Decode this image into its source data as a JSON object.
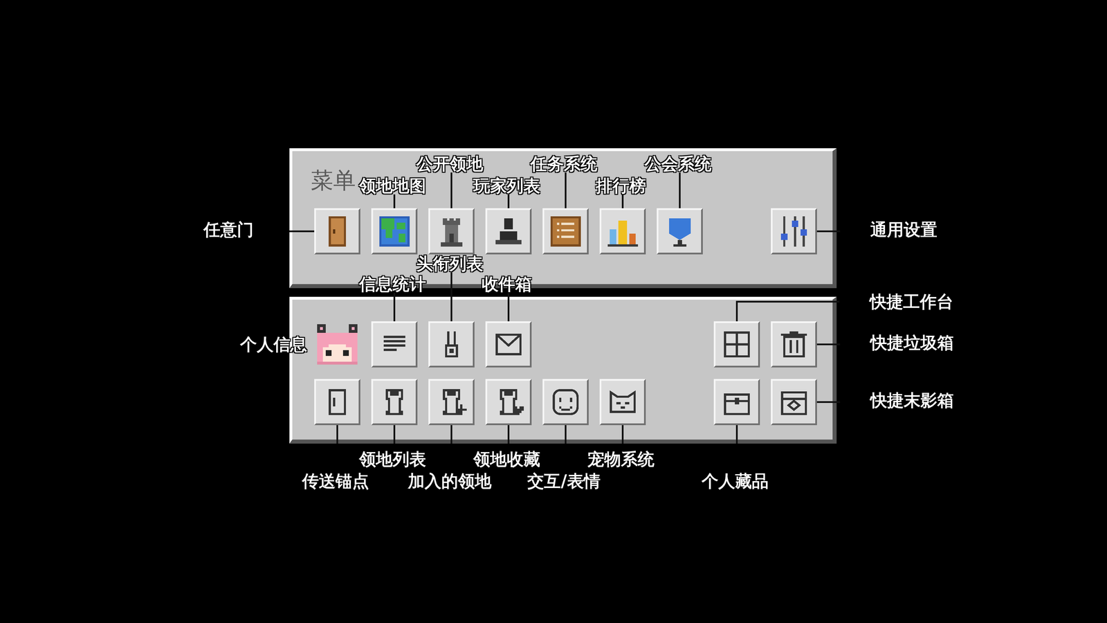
{
  "top_panel": {
    "title": "菜单",
    "left": [
      {
        "label": "任意门",
        "side": "left",
        "tier": 1,
        "kind": "slot"
      },
      {
        "label": "领地地图",
        "side": "top",
        "tier": 1,
        "kind": "slot"
      },
      {
        "label": "公开领地",
        "side": "top",
        "tier": 2,
        "kind": "slot"
      },
      {
        "label": "玩家列表",
        "side": "top",
        "tier": 1,
        "kind": "slot"
      },
      {
        "label": "任务系统",
        "side": "top",
        "tier": 2,
        "kind": "slot"
      },
      {
        "label": "排行榜",
        "side": "top",
        "tier": 1,
        "kind": "slot"
      },
      {
        "label": "公会系统",
        "side": "top",
        "tier": 2,
        "kind": "slot"
      }
    ],
    "right": [
      {
        "label": "通用设置",
        "side": "right",
        "tier": 1,
        "kind": "slot"
      }
    ]
  },
  "bottom_panel": {
    "rows": [
      {
        "left": [
          {
            "label": "个人信息",
            "side": "left",
            "tier": 1,
            "kind": "avatar"
          },
          {
            "label": "信息统计",
            "side": "top",
            "tier": 1,
            "kind": "slot"
          },
          {
            "label": "头衔列表",
            "side": "top",
            "tier": 2,
            "kind": "slot"
          },
          {
            "label": "收件箱",
            "side": "top",
            "tier": 1,
            "kind": "slot"
          }
        ],
        "right": [
          {
            "label": "快捷工作台",
            "side": "top-right",
            "tier": 1,
            "kind": "slot"
          },
          {
            "label": "快捷垃圾箱",
            "side": "right",
            "tier": 1,
            "kind": "slot"
          }
        ]
      },
      {
        "left": [
          {
            "label": "传送锚点",
            "side": "bottom",
            "tier": 2,
            "kind": "slot"
          },
          {
            "label": "领地列表",
            "side": "bottom",
            "tier": 1,
            "kind": "slot"
          },
          {
            "label": "加入的领地",
            "side": "bottom",
            "tier": 2,
            "kind": "slot"
          },
          {
            "label": "领地收藏",
            "side": "bottom",
            "tier": 1,
            "kind": "slot"
          },
          {
            "label": "交互/表情",
            "side": "bottom",
            "tier": 2,
            "kind": "slot"
          },
          {
            "label": "宠物系统",
            "side": "bottom",
            "tier": 1,
            "kind": "slot"
          }
        ],
        "right": [
          {
            "label": "个人藏品",
            "side": "bottom",
            "tier": 2,
            "kind": "slot"
          },
          {
            "label": "快捷末影箱",
            "side": "right",
            "tier": 1,
            "kind": "slot"
          }
        ]
      }
    ]
  }
}
